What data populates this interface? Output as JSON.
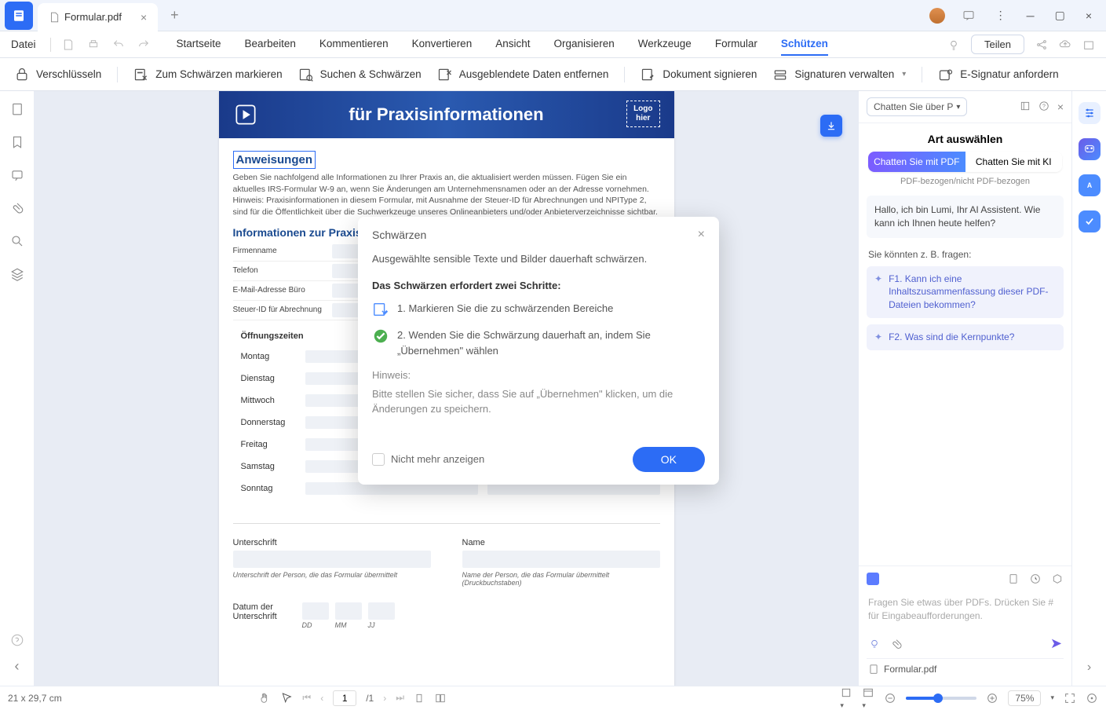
{
  "titlebar": {
    "tab_title": "Formular.pdf"
  },
  "ribbon": {
    "file": "Datei",
    "tabs": [
      "Startseite",
      "Bearbeiten",
      "Kommentieren",
      "Konvertieren",
      "Ansicht",
      "Organisieren",
      "Werkzeuge",
      "Formular",
      "Schützen"
    ],
    "active": "Schützen",
    "share": "Teilen"
  },
  "toolbar": {
    "encrypt": "Verschlüsseln",
    "mark_redact": "Zum Schwärzen markieren",
    "search_redact": "Suchen & Schwärzen",
    "remove_hidden": "Ausgeblendete Daten entfernen",
    "sign_doc": "Dokument signieren",
    "manage_sig": "Signaturen verwalten",
    "esign": "E-Signatur anfordern"
  },
  "doc": {
    "banner": "für Praxisinformationen",
    "banner_logo": "Logo\nhier",
    "h1": "Anweisungen",
    "text1": "Geben Sie nachfolgend alle Informationen zu Ihrer Praxis an, die aktualisiert werden müssen. Fügen Sie ein aktuelles IRS-Formular W-9 an, wenn Sie Änderungen am Unternehmensnamen oder an der Adresse vornehmen. Hinweis: Praxisinformationen in diesem Formular, mit Ausnahme der Steuer-ID für Abrechnungen und NPIType 2, sind für die Öffentlichkeit über die Suchwerkzeuge unseres Onlineanbieters und/oder Anbieterverzeichnisse sichtbar.",
    "h2": "Informationen zur Praxis",
    "fields": [
      "Firmenname",
      "Telefon",
      "E-Mail-Adresse Büro",
      "Steuer-ID für Abrechnung"
    ],
    "hours_h": "Öffnungszeiten",
    "days": [
      "Montag",
      "Dienstag",
      "Mittwoch",
      "Donnerstag",
      "Freitag",
      "Samstag",
      "Sonntag"
    ],
    "sig_label1": "Unterschrift",
    "sig_label2": "Name",
    "sig_hint1": "Unterschrift der Person, die das Formular übermittelt",
    "sig_hint2": "Name der Person, die das Formular übermittelt (Druckbuchstaben)",
    "date_label": "Datum der Unterschrift",
    "date_parts": [
      "DD",
      "MM",
      "JJ"
    ]
  },
  "modal": {
    "title": "Schwärzen",
    "desc": "Ausgewählte sensible Texte und Bilder dauerhaft schwärzen.",
    "strong": "Das Schwärzen erfordert zwei Schritte:",
    "step1": "1. Markieren Sie die zu schwärzenden Bereiche",
    "step2": "2. Wenden Sie die Schwärzung dauerhaft an, indem Sie „Übernehmen\" wählen",
    "hint_h": "Hinweis:",
    "hint": "Bitte stellen Sie sicher, dass Sie auf „Übernehmen\" klicken, um die Änderungen zu speichern.",
    "dont_show": "Nicht mehr anzeigen",
    "ok": "OK"
  },
  "ai": {
    "dropdown": "Chatten Sie über P",
    "title": "Art auswählen",
    "toggle1": "Chatten Sie mit PDF",
    "toggle2": "Chatten Sie mit KI",
    "sub": "PDF-bezogen/nicht PDF-bezogen",
    "greeting": "Hallo, ich bin Lumi, Ihr AI Assistent. Wie kann ich Ihnen heute helfen?",
    "hint": "Sie könnten z. B. fragen:",
    "sugg1": "F1. Kann ich eine Inhaltszusammenfassung dieser PDF-Dateien bekommen?",
    "sugg2": "F2. Was sind die Kernpunkte?",
    "input_placeholder": "Fragen Sie etwas über PDFs. Drücken Sie # für Eingabeaufforderungen.",
    "file": "Formular.pdf"
  },
  "status": {
    "dims": "21 x 29,7 cm",
    "page": "1",
    "pages": "/1",
    "zoom": "75%"
  }
}
